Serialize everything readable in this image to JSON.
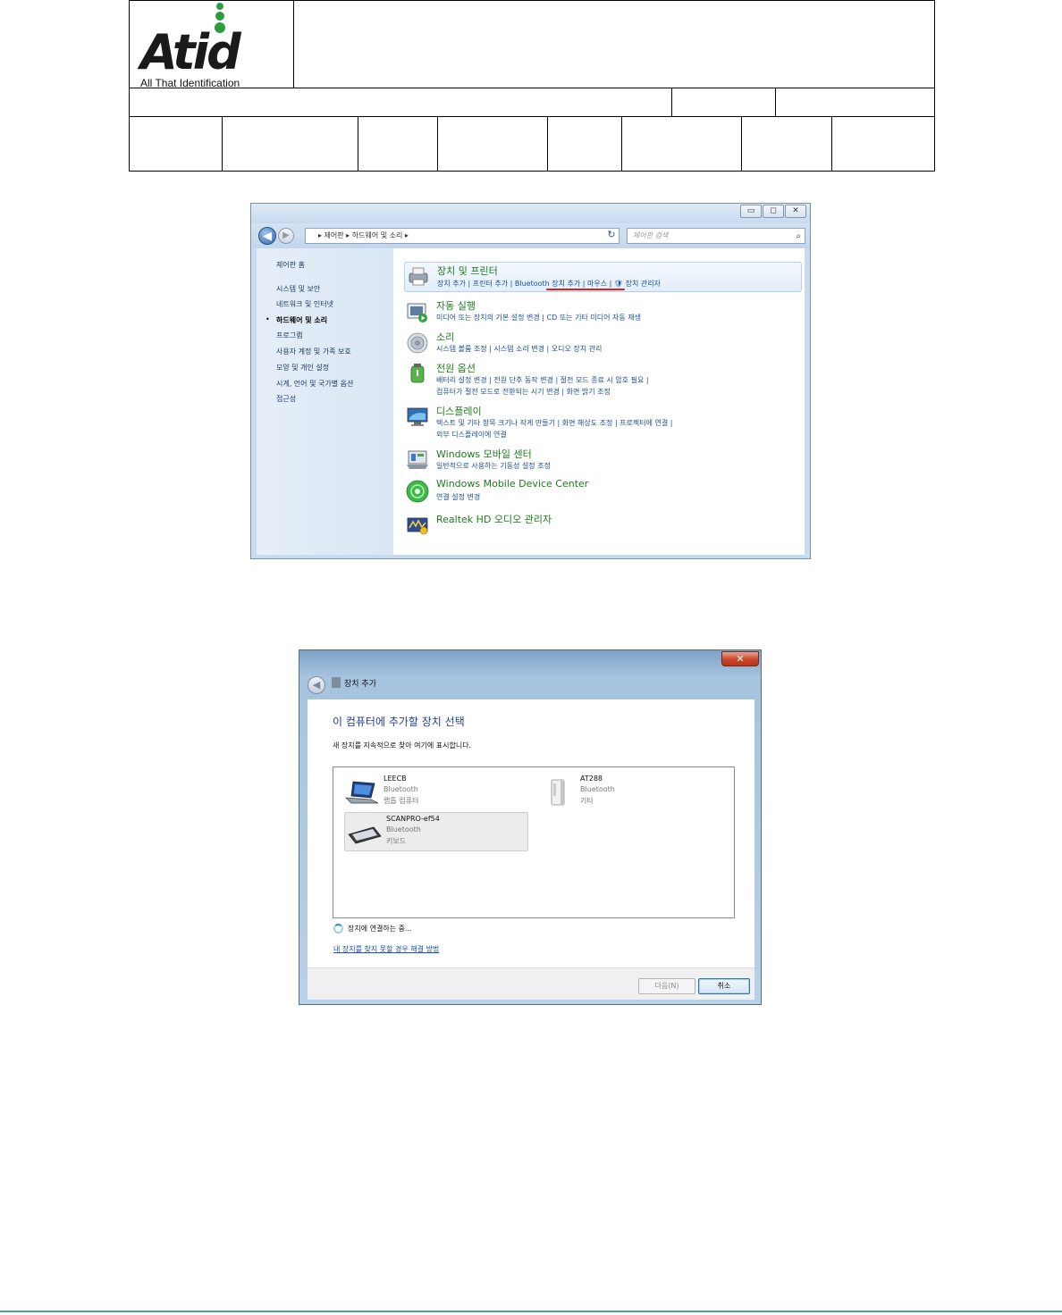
{
  "document_header": {
    "logo_text": "Atid",
    "logo_tagline": "All That Identification"
  },
  "control_panel": {
    "title_buttons": [
      "▭",
      "◻",
      "✕"
    ],
    "address": "▸  제어판  ▸  하드웨어 및 소리  ▸",
    "search_placeholder": "제어판 검색",
    "sidebar": {
      "items": [
        "제어판 홈",
        "시스템 및 보안",
        "네트워크 및 인터넷",
        "하드웨어 및 소리",
        "프로그램",
        "사용자 계정 및 가족 보호",
        "모양 및 개인 설정",
        "시계, 언어 및 국가별 옵션",
        "접근성"
      ],
      "active_index": 3
    },
    "categories": [
      {
        "title": "장치 및 프린터",
        "links": "장치 추가  |  프린터 추가  |  Bluetooth 장치 추가  |  마우스  |  🛡 장치 관리자",
        "icon": "printer-icon"
      },
      {
        "title": "자동 실행",
        "links": "미디어 또는 장치의 기본 설정 변경  |  CD 또는 기타 미디어 자동 재생",
        "icon": "autoplay-icon"
      },
      {
        "title": "소리",
        "links": "시스템 볼륨 조정  |  시스템 소리 변경  |  오디오 장치 관리",
        "icon": "speaker-icon"
      },
      {
        "title": "전원 옵션",
        "links": "배터리 설정 변경  |  전원 단추 동작 변경  |  절전 모드 종료 시 암호 필요  |",
        "links2": "컴퓨터가 절전 모드로 전환되는 시기 변경  |  화면 밝기 조정",
        "icon": "power-icon"
      },
      {
        "title": "디스플레이",
        "links": "텍스트 및 기타 항목 크기나 작게 만들기  |  화면 해상도 조정  |  프로젝터에 연결  |",
        "links2": "외부 디스플레이에 연결",
        "icon": "display-icon"
      },
      {
        "title": "Windows 모바일 센터",
        "links": "일반적으로 사용하는 기동성 설정 조정",
        "icon": "mobility-center-icon"
      },
      {
        "title": "Windows Mobile Device Center",
        "links": "연결 설정 변경",
        "icon": "device-center-icon"
      },
      {
        "title": "Realtek HD 오디오 관리자",
        "links": "",
        "icon": "realtek-audio-icon"
      }
    ]
  },
  "add_device_dialog": {
    "close_label": "✕",
    "title": "장치 추가",
    "heading": "이 컴퓨터에 추가할 장치 선택",
    "subtext": "새 장치를 지속적으로 찾아 여기에 표시합니다.",
    "devices": [
      {
        "name": "LEECB",
        "protocol": "Bluetooth",
        "type": "랩톱 컴퓨터",
        "icon": "laptop-icon"
      },
      {
        "name": "AT288",
        "protocol": "Bluetooth",
        "type": "기타",
        "icon": "generic-device-icon"
      },
      {
        "name": "SCANPRO-ef54",
        "protocol": "Bluetooth",
        "type": "키보드",
        "icon": "keyboard-icon",
        "selected": true
      }
    ],
    "status": "장치에 연결하는 중...",
    "help_link": "내 장치를 찾지 못할 경우 해결 방법",
    "next_button": "다음(N)",
    "cancel_button": "취소"
  },
  "colors": {
    "category_title": "#1e7a1e",
    "link": "#1a4f9c",
    "heading": "#1f3f92",
    "highlight_underline": "#e02020",
    "logo_green": "#2d9d3f",
    "footer_rule": "#4a9bb2"
  }
}
